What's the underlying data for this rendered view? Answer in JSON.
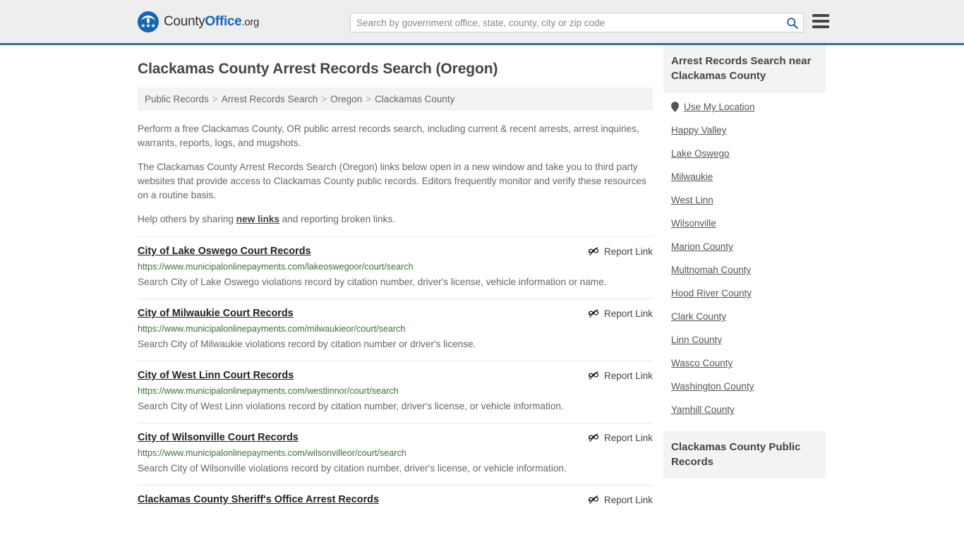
{
  "header": {
    "brand": {
      "part1": "County",
      "part2": "Office",
      "part3": ".org",
      "logo_icon": "eagle-stars-logo"
    },
    "search": {
      "placeholder": "Search by government office, state, county, city or zip code",
      "value": "",
      "search_icon": "search-icon"
    },
    "menu_icon": "hamburger-menu-icon"
  },
  "page": {
    "title": "Clackamas County Arrest Records Search (Oregon)"
  },
  "breadcrumb": {
    "separator": ">",
    "items": [
      {
        "label": "Public Records"
      },
      {
        "label": "Arrest Records Search"
      },
      {
        "label": "Oregon"
      },
      {
        "label": "Clackamas County"
      }
    ]
  },
  "intro": {
    "p1": "Perform a free Clackamas County, OR public arrest records search, including current & recent arrests, arrest inquiries, warrants, reports, logs, and mugshots.",
    "p2": "The Clackamas County Arrest Records Search (Oregon) links below open in a new window and take you to third party websites that provide access to Clackamas County public records. Editors frequently monitor and verify these resources on a routine basis.",
    "p3_before": "Help others by sharing ",
    "p3_link": "new links",
    "p3_after": " and reporting broken links."
  },
  "listings": {
    "report_label": "Report Link",
    "report_icon": "broken-link-icon",
    "items": [
      {
        "title": "City of Lake Oswego Court Records",
        "url": "https://www.municipalonlinepayments.com/lakeoswegoor/court/search",
        "desc": "Search City of Lake Oswego violations record by citation number, driver's license, vehicle information or name."
      },
      {
        "title": "City of Milwaukie Court Records",
        "url": "https://www.municipalonlinepayments.com/milwaukieor/court/search",
        "desc": "Search City of Milwaukie violations record by citation number or driver's license."
      },
      {
        "title": "City of West Linn Court Records",
        "url": "https://www.municipalonlinepayments.com/westlinnor/court/search",
        "desc": "Search City of West Linn violations record by citation number, driver's license, or vehicle information."
      },
      {
        "title": "City of Wilsonville Court Records",
        "url": "https://www.municipalonlinepayments.com/wilsonvilleor/court/search",
        "desc": "Search City of Wilsonville violations record by citation number, driver's license, or vehicle information."
      },
      {
        "title": "Clackamas County Sheriff's Office Arrest Records",
        "url": "",
        "desc": ""
      }
    ]
  },
  "sidebar": {
    "nearby": {
      "heading": "Arrest Records Search near Clackamas County",
      "use_my_location": {
        "label": "Use My Location",
        "icon": "map-pin-icon"
      },
      "links": [
        {
          "label": "Happy Valley"
        },
        {
          "label": "Lake Oswego"
        },
        {
          "label": "Milwaukie"
        },
        {
          "label": "West Linn"
        },
        {
          "label": "Wilsonville"
        },
        {
          "label": "Marion County"
        },
        {
          "label": "Multnomah County"
        },
        {
          "label": "Hood River County"
        },
        {
          "label": "Clark County"
        },
        {
          "label": "Linn County"
        },
        {
          "label": "Wasco County"
        },
        {
          "label": "Washington County"
        },
        {
          "label": "Yamhill County"
        }
      ]
    },
    "public_records": {
      "heading": "Clackamas County Public Records"
    }
  },
  "colors": {
    "brand_blue": "#1665b2",
    "header_bg": "#eeeeee",
    "header_rule": "#337094",
    "url_green": "#3b703a",
    "panel_gray": "#f3f3f3"
  }
}
